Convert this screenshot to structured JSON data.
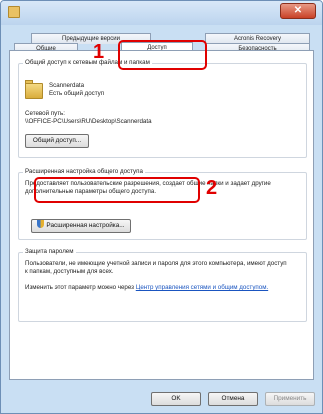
{
  "window": {
    "title": ""
  },
  "tabs": {
    "row1": [
      {
        "label": "Предыдущие версии"
      },
      {
        "label": "Acronis Recovery"
      }
    ],
    "row2": [
      {
        "label": "Общие"
      },
      {
        "label": "Доступ"
      },
      {
        "label": "Безопасность"
      }
    ]
  },
  "network_share": {
    "group_title": "Общий доступ к сетевым файлам и папкам",
    "folder_name": "Scannerdata",
    "share_status": "Есть общий доступ",
    "path_label": "Сетевой путь:",
    "path_value": "\\\\OFFICE-PC\\Users\\RU\\Desktop\\Scannerdata",
    "share_button": "Общий доступ..."
  },
  "advanced": {
    "group_title": "Расширенная настройка общего доступа",
    "description": "Предоставляет пользовательские разрешения, создает общие папки и задает другие дополнительные параметры общего доступа.",
    "button": "Расширенная настройка..."
  },
  "password": {
    "group_title": "Защита паролем",
    "description": "Пользователи, не имеющие учетной записи и пароля для этого компьютера, имеют доступ к папкам, доступным для всех.",
    "change_prefix": "Изменить этот параметр можно через ",
    "link": "Центр управления сетями и общим доступом."
  },
  "footer": {
    "ok": "OK",
    "cancel": "Отмена",
    "apply": "Применить"
  },
  "callouts": {
    "one": "1",
    "two": "2"
  },
  "colors": {
    "callout": "#e00000",
    "link": "#1a55c0"
  }
}
